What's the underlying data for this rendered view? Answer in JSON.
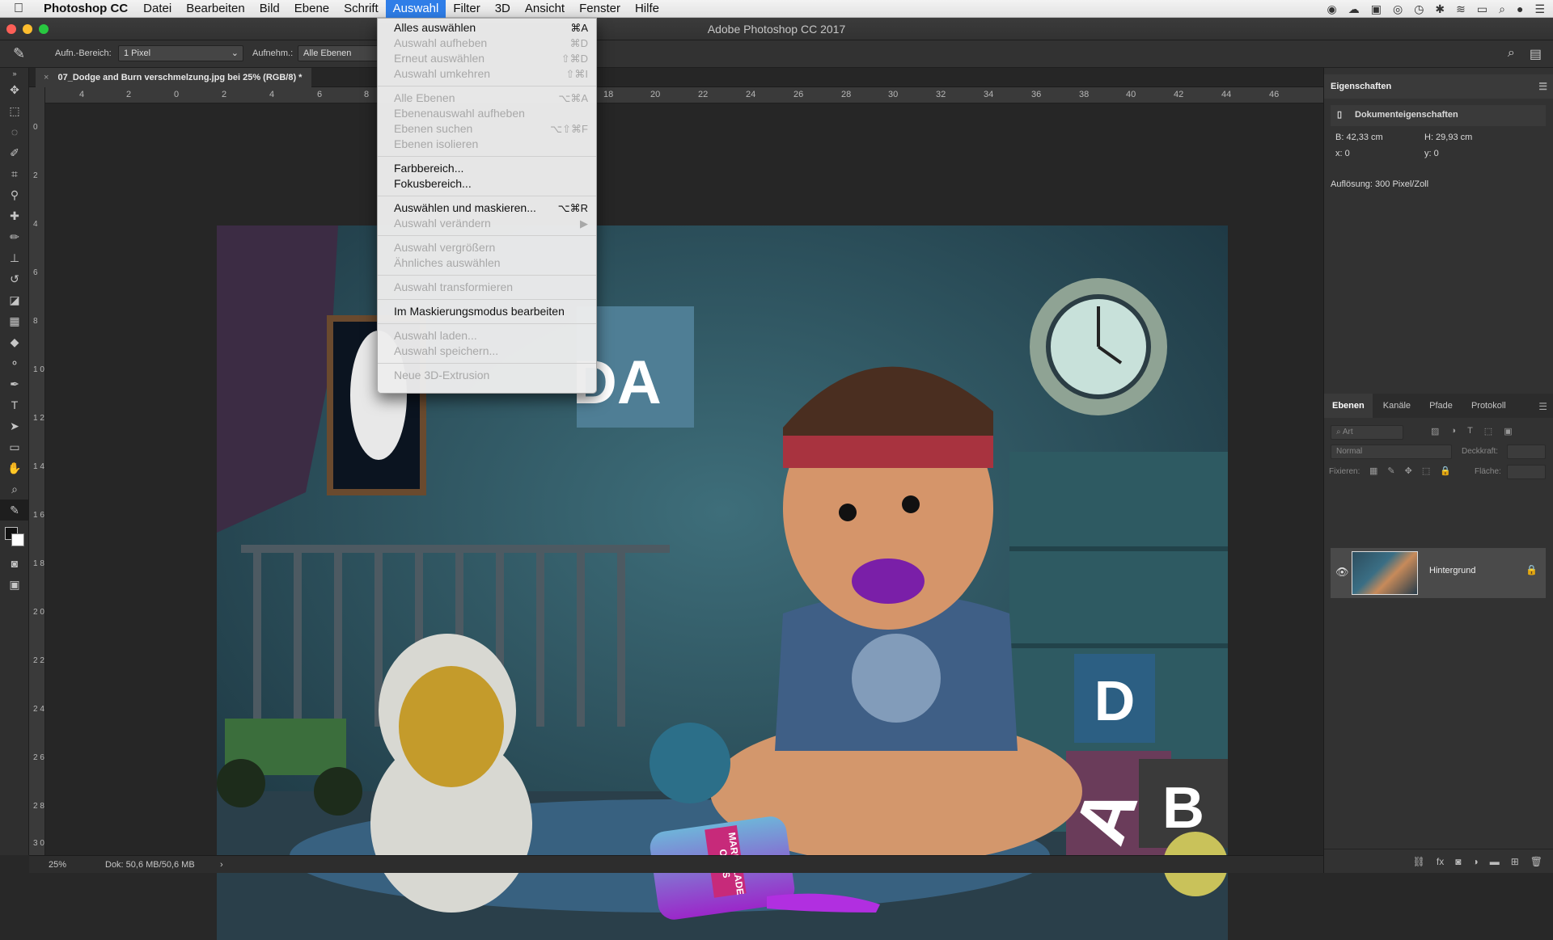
{
  "menubar": {
    "app_name": "Photoshop CC",
    "menus": [
      "Datei",
      "Bearbeiten",
      "Bild",
      "Ebene",
      "Schrift",
      "Auswahl",
      "Filter",
      "3D",
      "Ansicht",
      "Fenster",
      "Hilfe"
    ]
  },
  "window": {
    "title": "Adobe Photoshop CC 2017"
  },
  "options_bar": {
    "sample_size_label": "Aufn.-Bereich:",
    "sample_size_value": "1 Pixel",
    "sample_label": "Aufnehm.:",
    "sample_value": "Alle Ebenen"
  },
  "document": {
    "tab_title": "07_Dodge and Burn verschmelzung.jpg bei 25% (RGB/8) *"
  },
  "ruler_h": [
    "4",
    "2",
    "0",
    "2",
    "4",
    "6",
    "8",
    "18",
    "20",
    "22",
    "24",
    "26",
    "28",
    "30",
    "32",
    "34",
    "36",
    "38",
    "40",
    "42",
    "44",
    "46"
  ],
  "ruler_v": [
    "0",
    "2",
    "4",
    "6",
    "8",
    "1 0",
    "1 2",
    "1 4",
    "1 6",
    "1 8",
    "2 0",
    "2 2",
    "2 4",
    "2 6",
    "2 8",
    "3 0"
  ],
  "dropdown": {
    "items": [
      {
        "label": "Alles auswählen",
        "shortcut": "⌘A",
        "disabled": false
      },
      {
        "label": "Auswahl aufheben",
        "shortcut": "⌘D",
        "disabled": true
      },
      {
        "label": "Erneut auswählen",
        "shortcut": "⇧⌘D",
        "disabled": true
      },
      {
        "label": "Auswahl umkehren",
        "shortcut": "⇧⌘I",
        "disabled": true
      },
      {
        "sep": true
      },
      {
        "label": "Alle Ebenen",
        "shortcut": "⌥⌘A",
        "disabled": true
      },
      {
        "label": "Ebenenauswahl aufheben",
        "shortcut": "",
        "disabled": true
      },
      {
        "label": "Ebenen suchen",
        "shortcut": "⌥⇧⌘F",
        "disabled": true
      },
      {
        "label": "Ebenen isolieren",
        "shortcut": "",
        "disabled": true
      },
      {
        "sep": true
      },
      {
        "label": "Farbbereich...",
        "shortcut": "",
        "disabled": false
      },
      {
        "label": "Fokusbereich...",
        "shortcut": "",
        "disabled": false
      },
      {
        "sep": true
      },
      {
        "label": "Auswählen und maskieren...",
        "shortcut": "⌥⌘R",
        "disabled": false
      },
      {
        "label": "Auswahl verändern",
        "shortcut": "▶",
        "disabled": true
      },
      {
        "sep": true
      },
      {
        "label": "Auswahl vergrößern",
        "shortcut": "",
        "disabled": true
      },
      {
        "label": "Ähnliches auswählen",
        "shortcut": "",
        "disabled": true
      },
      {
        "sep": true
      },
      {
        "label": "Auswahl transformieren",
        "shortcut": "",
        "disabled": true
      },
      {
        "sep": true
      },
      {
        "label": "Im Maskierungsmodus bearbeiten",
        "shortcut": "",
        "disabled": false
      },
      {
        "sep": true
      },
      {
        "label": "Auswahl laden...",
        "shortcut": "",
        "disabled": true
      },
      {
        "label": "Auswahl speichern...",
        "shortcut": "",
        "disabled": true
      },
      {
        "sep": true
      },
      {
        "label": "Neue 3D-Extrusion",
        "shortcut": "",
        "disabled": true
      }
    ]
  },
  "properties": {
    "title": "Eigenschaften",
    "subtitle": "Dokumenteigenschaften",
    "width": "B: 42,33 cm",
    "height": "H: 29,93 cm",
    "x": "x: 0",
    "y": "y: 0",
    "resolution": "Auflösung: 300 Pixel/Zoll"
  },
  "layers": {
    "tabs": [
      "Ebenen",
      "Kanäle",
      "Pfade",
      "Protokoll"
    ],
    "filter_placeholder": "Art",
    "blend_mode": "Normal",
    "opacity_label": "Deckkraft:",
    "lock_label": "Fixieren:",
    "fill_label": "Fläche:",
    "layer_name": "Hintergrund"
  },
  "statusbar": {
    "zoom": "25%",
    "doc_size": "Dok: 50,6 MB/50,6 MB",
    "arrow": "›"
  },
  "artwork_text": {
    "letters_da": "DA",
    "block_d": "D",
    "block_a": "A",
    "block_b": "B",
    "jar_label_1": "OMAS",
    "jar_label_2": "MARMELADE"
  }
}
